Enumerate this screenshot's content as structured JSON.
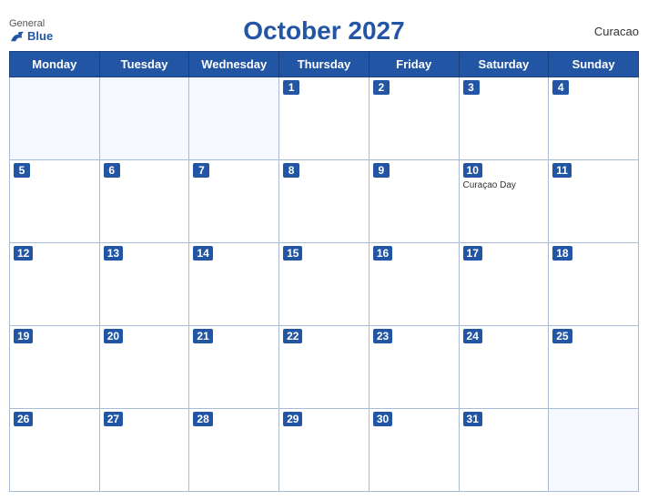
{
  "header": {
    "logo_general": "General",
    "logo_blue": "Blue",
    "title": "October 2027",
    "region": "Curacao"
  },
  "calendar": {
    "days_of_week": [
      "Monday",
      "Tuesday",
      "Wednesday",
      "Thursday",
      "Friday",
      "Saturday",
      "Sunday"
    ],
    "weeks": [
      [
        {
          "date": "",
          "empty": true
        },
        {
          "date": "",
          "empty": true
        },
        {
          "date": "",
          "empty": true
        },
        {
          "date": "1"
        },
        {
          "date": "2"
        },
        {
          "date": "3"
        },
        {
          "date": "4"
        }
      ],
      [
        {
          "date": "5"
        },
        {
          "date": "6"
        },
        {
          "date": "7"
        },
        {
          "date": "8"
        },
        {
          "date": "9"
        },
        {
          "date": "10",
          "event": "Curaçao Day"
        },
        {
          "date": "11"
        }
      ],
      [
        {
          "date": "12"
        },
        {
          "date": "13"
        },
        {
          "date": "14"
        },
        {
          "date": "15"
        },
        {
          "date": "16"
        },
        {
          "date": "17"
        },
        {
          "date": "18"
        }
      ],
      [
        {
          "date": "19"
        },
        {
          "date": "20"
        },
        {
          "date": "21"
        },
        {
          "date": "22"
        },
        {
          "date": "23"
        },
        {
          "date": "24"
        },
        {
          "date": "25"
        }
      ],
      [
        {
          "date": "26"
        },
        {
          "date": "27"
        },
        {
          "date": "28"
        },
        {
          "date": "29"
        },
        {
          "date": "30"
        },
        {
          "date": "31"
        },
        {
          "date": "",
          "empty": true
        }
      ]
    ]
  }
}
